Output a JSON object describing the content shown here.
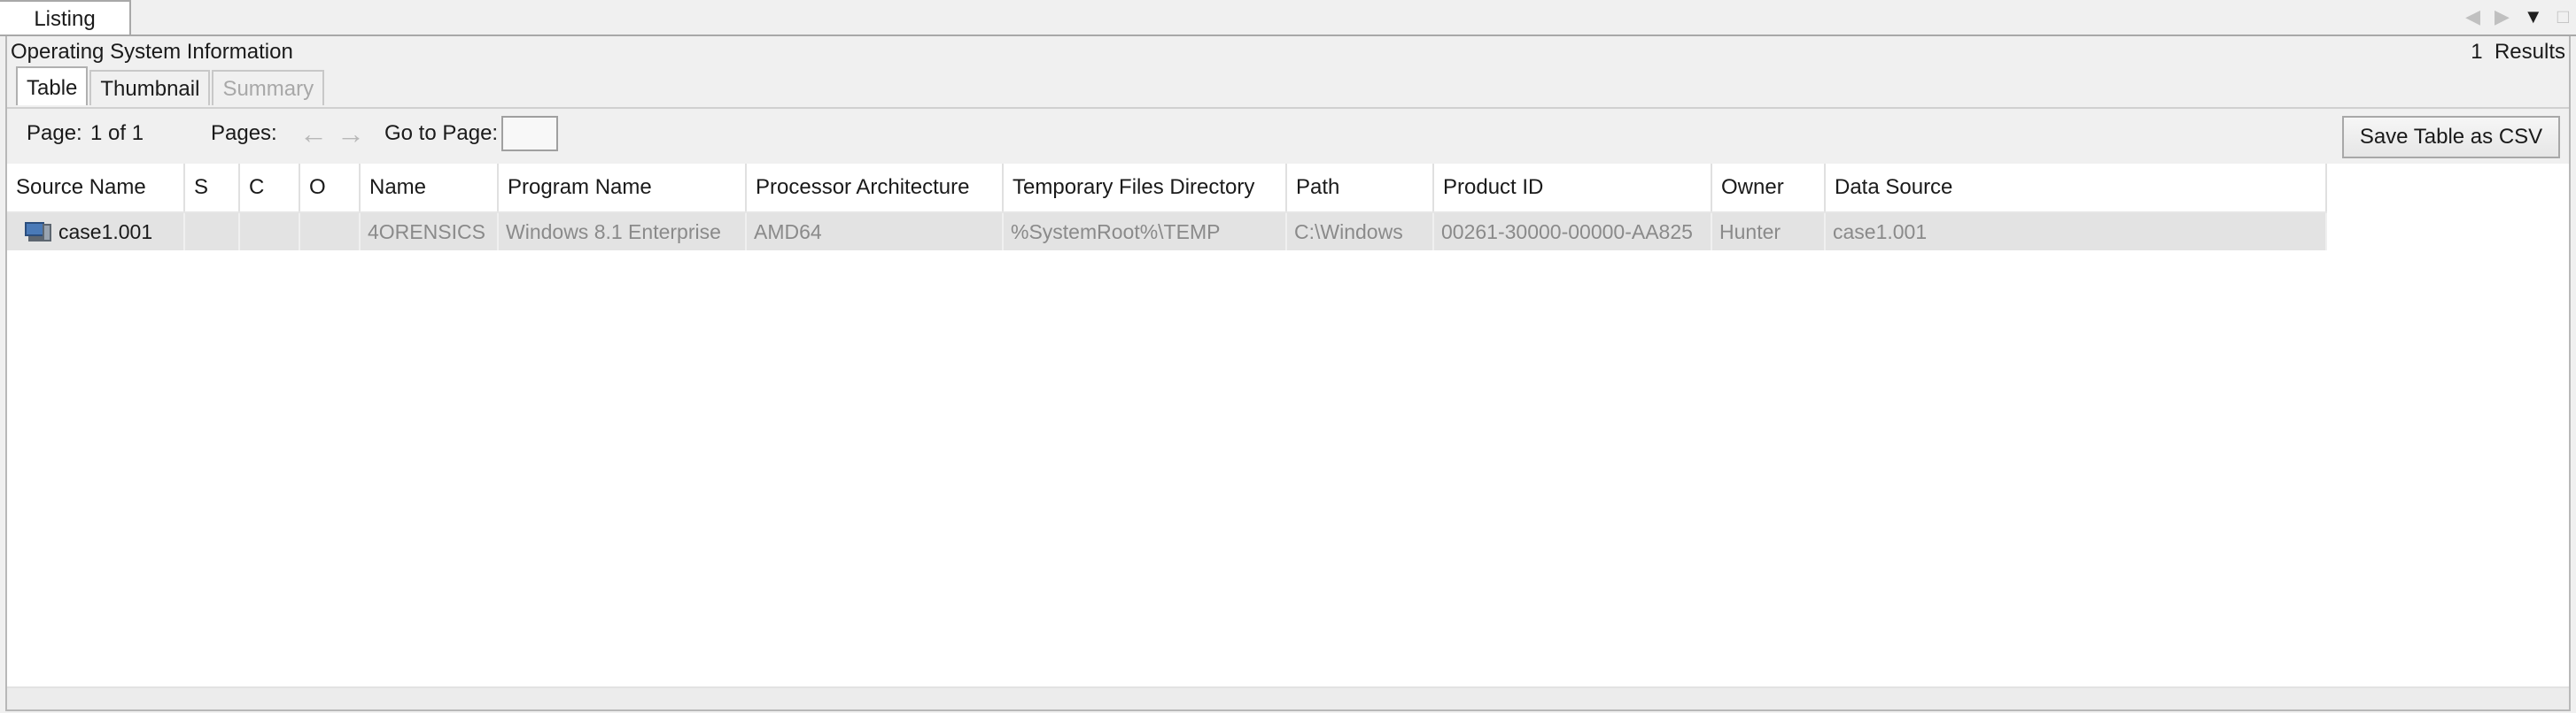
{
  "window": {
    "tab_label": "Listing",
    "controls": [
      "left-arrow-icon",
      "right-arrow-icon",
      "dropdown-icon",
      "maximize-icon"
    ]
  },
  "header": {
    "title": "Operating System Information",
    "results_count": "1",
    "results_label": "Results"
  },
  "view_tabs": [
    {
      "label": "Table",
      "state": "active"
    },
    {
      "label": "Thumbnail",
      "state": "normal"
    },
    {
      "label": "Summary",
      "state": "disabled"
    }
  ],
  "pager": {
    "page_label": "Page:",
    "page_value": "1 of 1",
    "pages_label": "Pages:",
    "goto_label": "Go to Page:",
    "goto_value": "",
    "save_label": "Save Table as CSV"
  },
  "table": {
    "columns": [
      "Source Name",
      "S",
      "C",
      "O",
      "Name",
      "Program Name",
      "Processor Architecture",
      "Temporary Files Directory",
      "Path",
      "Product ID",
      "Owner",
      "Data Source"
    ],
    "rows": [
      [
        "case1.001",
        "",
        "",
        "",
        "4ORENSICS",
        "Windows 8.1 Enterprise",
        "AMD64",
        "%SystemRoot%\\TEMP",
        "C:\\Windows",
        "00261-30000-00000-AA825",
        "Hunter",
        "case1.001"
      ]
    ]
  },
  "colors": {
    "selected_row": "#e3e3e3",
    "muted_text": "#8a8a8a",
    "border": "#a8a8a8"
  }
}
